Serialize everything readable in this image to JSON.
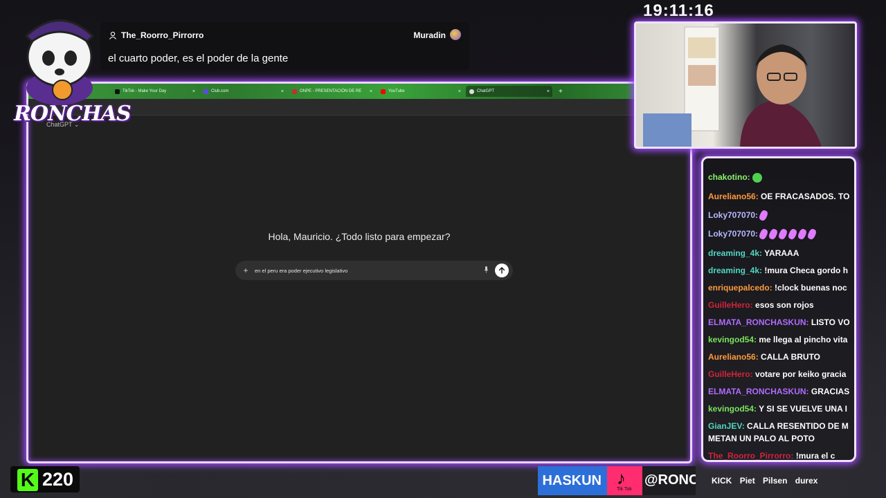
{
  "overlay": {
    "clock": "19:11:16",
    "logo_text": "RONCHAS",
    "kick_count": "220"
  },
  "highlight_message": {
    "username": "The_Roorro_Pirrorro",
    "badge_user": "Muradin",
    "text": "el cuarto poder, es el poder de la gente"
  },
  "browser": {
    "tabs": [
      {
        "label": "TikTok - Make Your Day",
        "favicon_color": "#111111"
      },
      {
        "label": "Club.com",
        "favicon_color": "#5b4be0"
      },
      {
        "label": "ONPE - PRESENTACIÓN DE RE",
        "favicon_color": "#c23030"
      },
      {
        "label": "YouTube",
        "favicon_color": "#ff0000"
      },
      {
        "label": "ChatGPT",
        "favicon_color": "#dddddd"
      }
    ],
    "new_tab_icon": "plus-icon"
  },
  "chatgpt": {
    "model_label": "ChatGPT ⌄",
    "greeting": "Hola, Mauricio. ¿Todo listo para empezar?",
    "composer_text": "en el peru era poder ejecutivo legislativo",
    "icons": [
      "plus-icon",
      "mic-icon",
      "send-arrow-icon"
    ]
  },
  "chat": {
    "lines": [
      {
        "nick": "chakotino:",
        "msg": "",
        "color": "#8cf26b",
        "emotes": 1,
        "emote": "green"
      },
      {
        "nick": "Aureliano56:",
        "msg": " OE FRACASADOS. TO",
        "color": "#ff9a3c"
      },
      {
        "nick": "Loky707070:",
        "msg": "",
        "color": "#b9b9ff",
        "emotes": 1,
        "emote": "pink"
      },
      {
        "nick": "Loky707070:",
        "msg": "",
        "color": "#b9b9ff",
        "emotes": 6,
        "emote": "pink"
      },
      {
        "nick": "dreaming_4k:",
        "msg": " YARAAA",
        "color": "#52d6c0"
      },
      {
        "nick": "dreaming_4k:",
        "msg": " !mura Checa gordo h",
        "color": "#52d6c0"
      },
      {
        "nick": "enriquepalcedo:",
        "msg": " !clock buenas noc",
        "color": "#ff9a3c"
      },
      {
        "nick": "GuilleHero:",
        "msg": " esos son rojos",
        "color": "#d2243a"
      },
      {
        "nick": "ELMATA_RONCHASKUN:",
        "msg": " LISTO VO",
        "color": "#b06bff"
      },
      {
        "nick": "kevingod54:",
        "msg": " me llega al pincho vita",
        "color": "#7be35a"
      },
      {
        "nick": "Aureliano56:",
        "msg": " CALLA BRUTO",
        "color": "#ff9a3c"
      },
      {
        "nick": "GuilleHero:",
        "msg": " votare por keiko gracia",
        "color": "#d2243a"
      },
      {
        "nick": "ELMATA_RONCHASKUN:",
        "msg": " GRACIAS",
        "color": "#b06bff"
      },
      {
        "nick": "kevingod54:",
        "msg": " Y SI SE VUELVE UNA I",
        "color": "#7be35a"
      },
      {
        "nick": "GianJEV:",
        "msg": " CALLA RESENTIDO DE M",
        "color": "#52d6c0"
      },
      {
        "nick": "",
        "msg": "METAN UN PALO AL POTO",
        "color": "#ffffff"
      },
      {
        "nick": "The_Roorro_Pirrorro:",
        "msg": " !mura el c",
        "color": "#d2243a"
      }
    ]
  },
  "banner": {
    "name_fragment": "HASKUN",
    "tiktok_label": "Tik Tok",
    "handle": "@RONC",
    "sponsors": [
      "KICK",
      "Piet",
      "Pilsen",
      "durex"
    ]
  }
}
